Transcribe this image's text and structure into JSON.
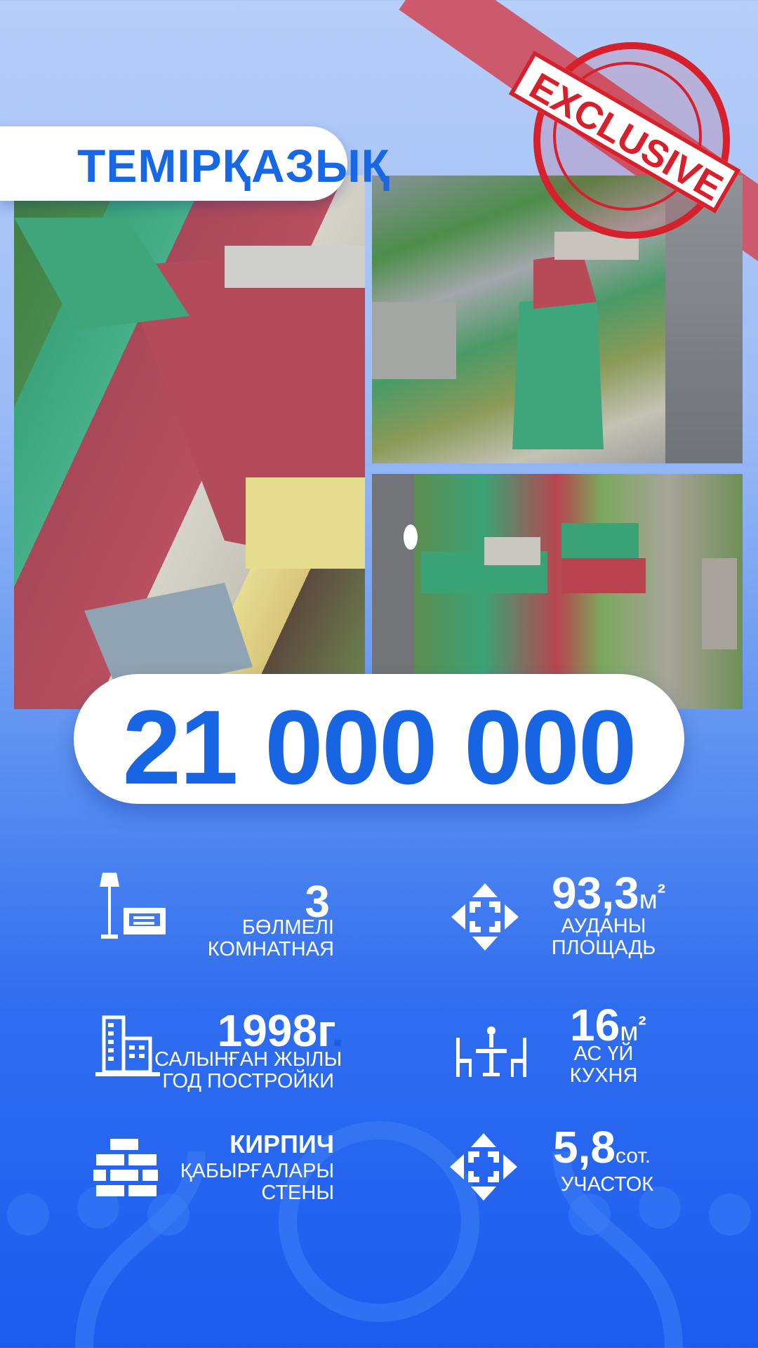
{
  "title": "ТЕМІРҚАЗЫҚ",
  "stamp": "EXCLUSIVE",
  "price": "21 000 000",
  "features": {
    "rooms": {
      "value": "3",
      "label_kz": "БӨЛМЕЛІ",
      "label_ru": "КОМНАТНАЯ",
      "icon": "lamp-sofa-icon"
    },
    "area": {
      "value": "93,3",
      "unit": "м",
      "sup": "²",
      "label_kz": "АУДАНЫ",
      "label_ru": "ПЛОЩАДЬ",
      "icon": "expand-arrows-icon"
    },
    "year": {
      "value": "1998г",
      "dot": ".",
      "label_kz": "САЛЫНҒАН ЖЫЛЫ",
      "label_ru": "ГОД ПОСТРОЙКИ",
      "icon": "building-icon"
    },
    "kitchen": {
      "value": "16",
      "unit": "м",
      "sup": "²",
      "label_kz": "АС ҮЙ",
      "label_ru": "КУХНЯ",
      "icon": "dining-table-icon"
    },
    "walls": {
      "value": "КИРПИЧ",
      "label_kz": "ҚАБЫРҒАЛАРЫ",
      "label_ru": "СТЕНЫ",
      "icon": "bricks-icon"
    },
    "plot": {
      "value": "5,8",
      "unit": "сот.",
      "label": "УЧАСТОК",
      "icon": "expand-arrows-icon"
    }
  }
}
